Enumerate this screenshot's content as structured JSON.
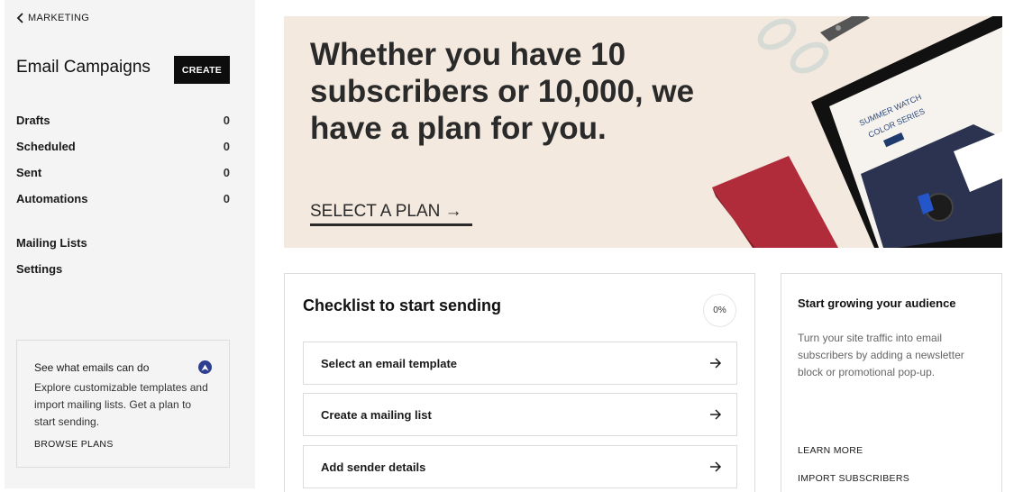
{
  "sidebar": {
    "back_label": "MARKETING",
    "title": "Email Campaigns",
    "create_label": "CREATE",
    "nav_items": [
      {
        "label": "Drafts",
        "count": "0"
      },
      {
        "label": "Scheduled",
        "count": "0"
      },
      {
        "label": "Sent",
        "count": "0"
      },
      {
        "label": "Automations",
        "count": "0"
      }
    ],
    "secondary_items": [
      {
        "label": "Mailing Lists"
      },
      {
        "label": "Settings"
      }
    ],
    "promo": {
      "title": "See what emails can do",
      "body": "Explore customizable templates and import mailing lists. Get a plan to start sending.",
      "link": "BROWSE PLANS",
      "icon": "collapse-up-icon",
      "icon_color": "#2e3f8f"
    }
  },
  "hero": {
    "title": "Whether you have 10 subscribers or 10,000, we have a plan for you.",
    "cta": "SELECT A PLAN →",
    "image": {
      "description": "Tablet showing email editor with scissors and red notebook",
      "tablet_headline_1": "SUMMER WATCH",
      "tablet_headline_2": "COLOR SERIES"
    },
    "background": "#f3e9df"
  },
  "checklist": {
    "title": "Checklist to start sending",
    "progress": "0%",
    "progress_value": 0,
    "items": [
      {
        "label": "Select an email template",
        "icon": "arrow-right-icon"
      },
      {
        "label": "Create a mailing list",
        "icon": "arrow-right-icon"
      },
      {
        "label": "Add sender details",
        "icon": "arrow-right-icon"
      }
    ]
  },
  "audience": {
    "title": "Start growing your audience",
    "body": "Turn your site traffic into email subscribers by adding a newsletter block or promotional pop-up.",
    "links": [
      "LEARN MORE",
      "IMPORT SUBSCRIBERS"
    ]
  }
}
